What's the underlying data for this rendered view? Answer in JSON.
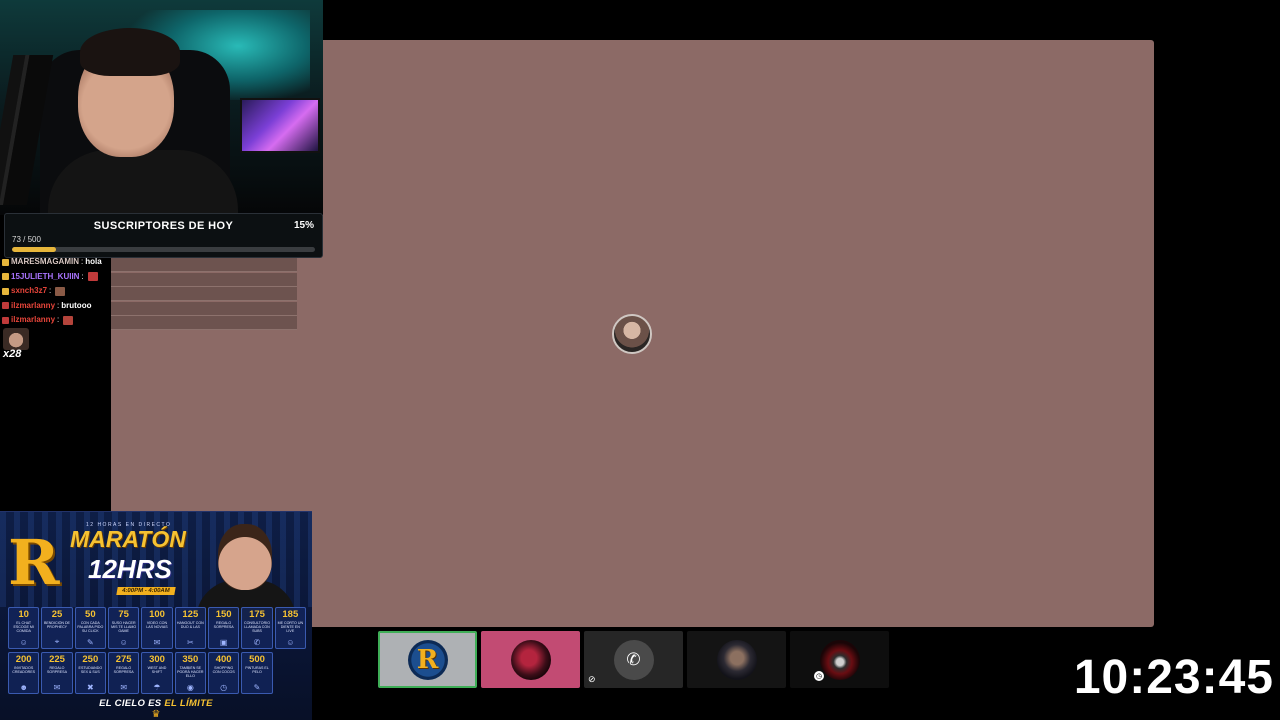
{
  "subs_widget": {
    "title": "SUSCRIPTORES DE HOY",
    "percent": "15%",
    "count": "73 / 500",
    "progress": 0.146
  },
  "chat": {
    "messages": [
      {
        "user": "MARESMAGAMIN",
        "sep": ":",
        "text": "hola",
        "color": "#d9c7c2",
        "badge_color": "#e7b63b",
        "emote": ""
      },
      {
        "user": "15JULIETH_KUIIN",
        "sep": ":",
        "text": "",
        "color": "#a974ff",
        "badge_color": "#e7b63b",
        "emote": "#c03a3a"
      },
      {
        "user": "sxnch3z7",
        "sep": ":",
        "text": "",
        "color": "#e7453a",
        "badge_color": "#e7b63b",
        "emote": "#8a5a46"
      },
      {
        "user": "ilzmarlanny",
        "sep": ":",
        "text": "brutooo",
        "color": "#e7453a",
        "badge_color": "#c03a3a",
        "emote": ""
      },
      {
        "user": "ilzmarlanny",
        "sep": ":",
        "text": "",
        "color": "#e7453a",
        "badge_color": "#c03a3a",
        "emote": "#b4443b"
      }
    ],
    "combo_count": "x28"
  },
  "banner": {
    "pre_title": "12 HORAS EN DIRECTO",
    "logo_letter": "R",
    "title": "MARATÓN",
    "subtitle": "12HRS",
    "times": "4:00PM - 4:00AM",
    "goals": [
      {
        "num": "10",
        "text": "EL CHAT ESCOGE MI COMIDA",
        "icon": "☺"
      },
      {
        "num": "25",
        "text": "BENDICIÓN DE PROPHECY",
        "icon": "⌖"
      },
      {
        "num": "50",
        "text": "CON CADA PALABRA PIDO SU CLICK",
        "icon": "✎"
      },
      {
        "num": "75",
        "text": "SUSO HACER MIS TE LLAMO GAME",
        "icon": "☺"
      },
      {
        "num": "100",
        "text": "VIDEO CON LAS NOVIAS",
        "icon": "✉"
      },
      {
        "num": "125",
        "text": "HANGOUT CON DUO & LAS",
        "icon": "✂"
      },
      {
        "num": "150",
        "text": "REGALO SORPRESA",
        "icon": "▣"
      },
      {
        "num": "175",
        "text": "CONSULTORIO LLAMADA CON SUBS",
        "icon": "✆"
      },
      {
        "num": "185",
        "text": "ME CORTO UN DIENTE EN LIVE",
        "icon": "☺"
      },
      {
        "num": "200",
        "text": "INVITADOS CREADORES",
        "icon": "☻"
      },
      {
        "num": "225",
        "text": "REGALO SORPRESA",
        "icon": "✉"
      },
      {
        "num": "250",
        "text": "ESTUDIANDO SEX & SUS",
        "icon": "✖"
      },
      {
        "num": "275",
        "text": "REGALO SORPRESA",
        "icon": "✉"
      },
      {
        "num": "300",
        "text": "WEST AND SHIFT",
        "icon": "☂"
      },
      {
        "num": "350",
        "text": "TAMBIÉN SE PODRÁ HACER ELLO",
        "icon": "◉"
      },
      {
        "num": "400",
        "text": "SHOPPING CON COCOS",
        "icon": "◷"
      },
      {
        "num": "500",
        "text": "PINTURAS EL PELO",
        "icon": "✎"
      }
    ],
    "motto_prefix": "EL CIELO ES",
    "motto_gold": "EL LÍMITE"
  },
  "call": {
    "participants": [
      {
        "name": "participant-r-logo",
        "active": true
      },
      {
        "name": "participant-pink",
        "active": false
      },
      {
        "name": "participant-phone",
        "active": false
      },
      {
        "name": "participant-dark",
        "active": false
      },
      {
        "name": "participant-red",
        "active": false
      }
    ]
  },
  "clock": "10:23:45"
}
